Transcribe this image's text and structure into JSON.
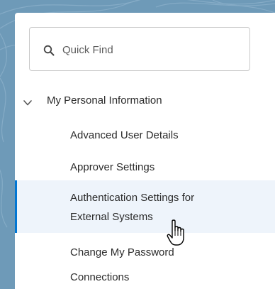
{
  "theme": {
    "accent": "#0176d3",
    "active_bg": "#eef4fb",
    "backdrop": "#6e9ab8"
  },
  "search": {
    "icon": "search-icon",
    "placeholder": "Quick Find"
  },
  "nav": {
    "section": {
      "icon": "chevron-down-icon",
      "label": "My Personal Information",
      "expanded": true
    },
    "items": [
      {
        "lines": [
          "Advanced User Details"
        ],
        "active": false
      },
      {
        "lines": [
          "Approver Settings"
        ],
        "active": false
      },
      {
        "lines": [
          "Authentication Settings for",
          "External Systems"
        ],
        "active": true
      },
      {
        "lines": [
          "Change My Password"
        ],
        "active": false
      },
      {
        "lines": [
          "Connections"
        ],
        "active": false
      }
    ]
  },
  "pointer": {
    "icon": "hand-pointer-cursor-icon"
  }
}
